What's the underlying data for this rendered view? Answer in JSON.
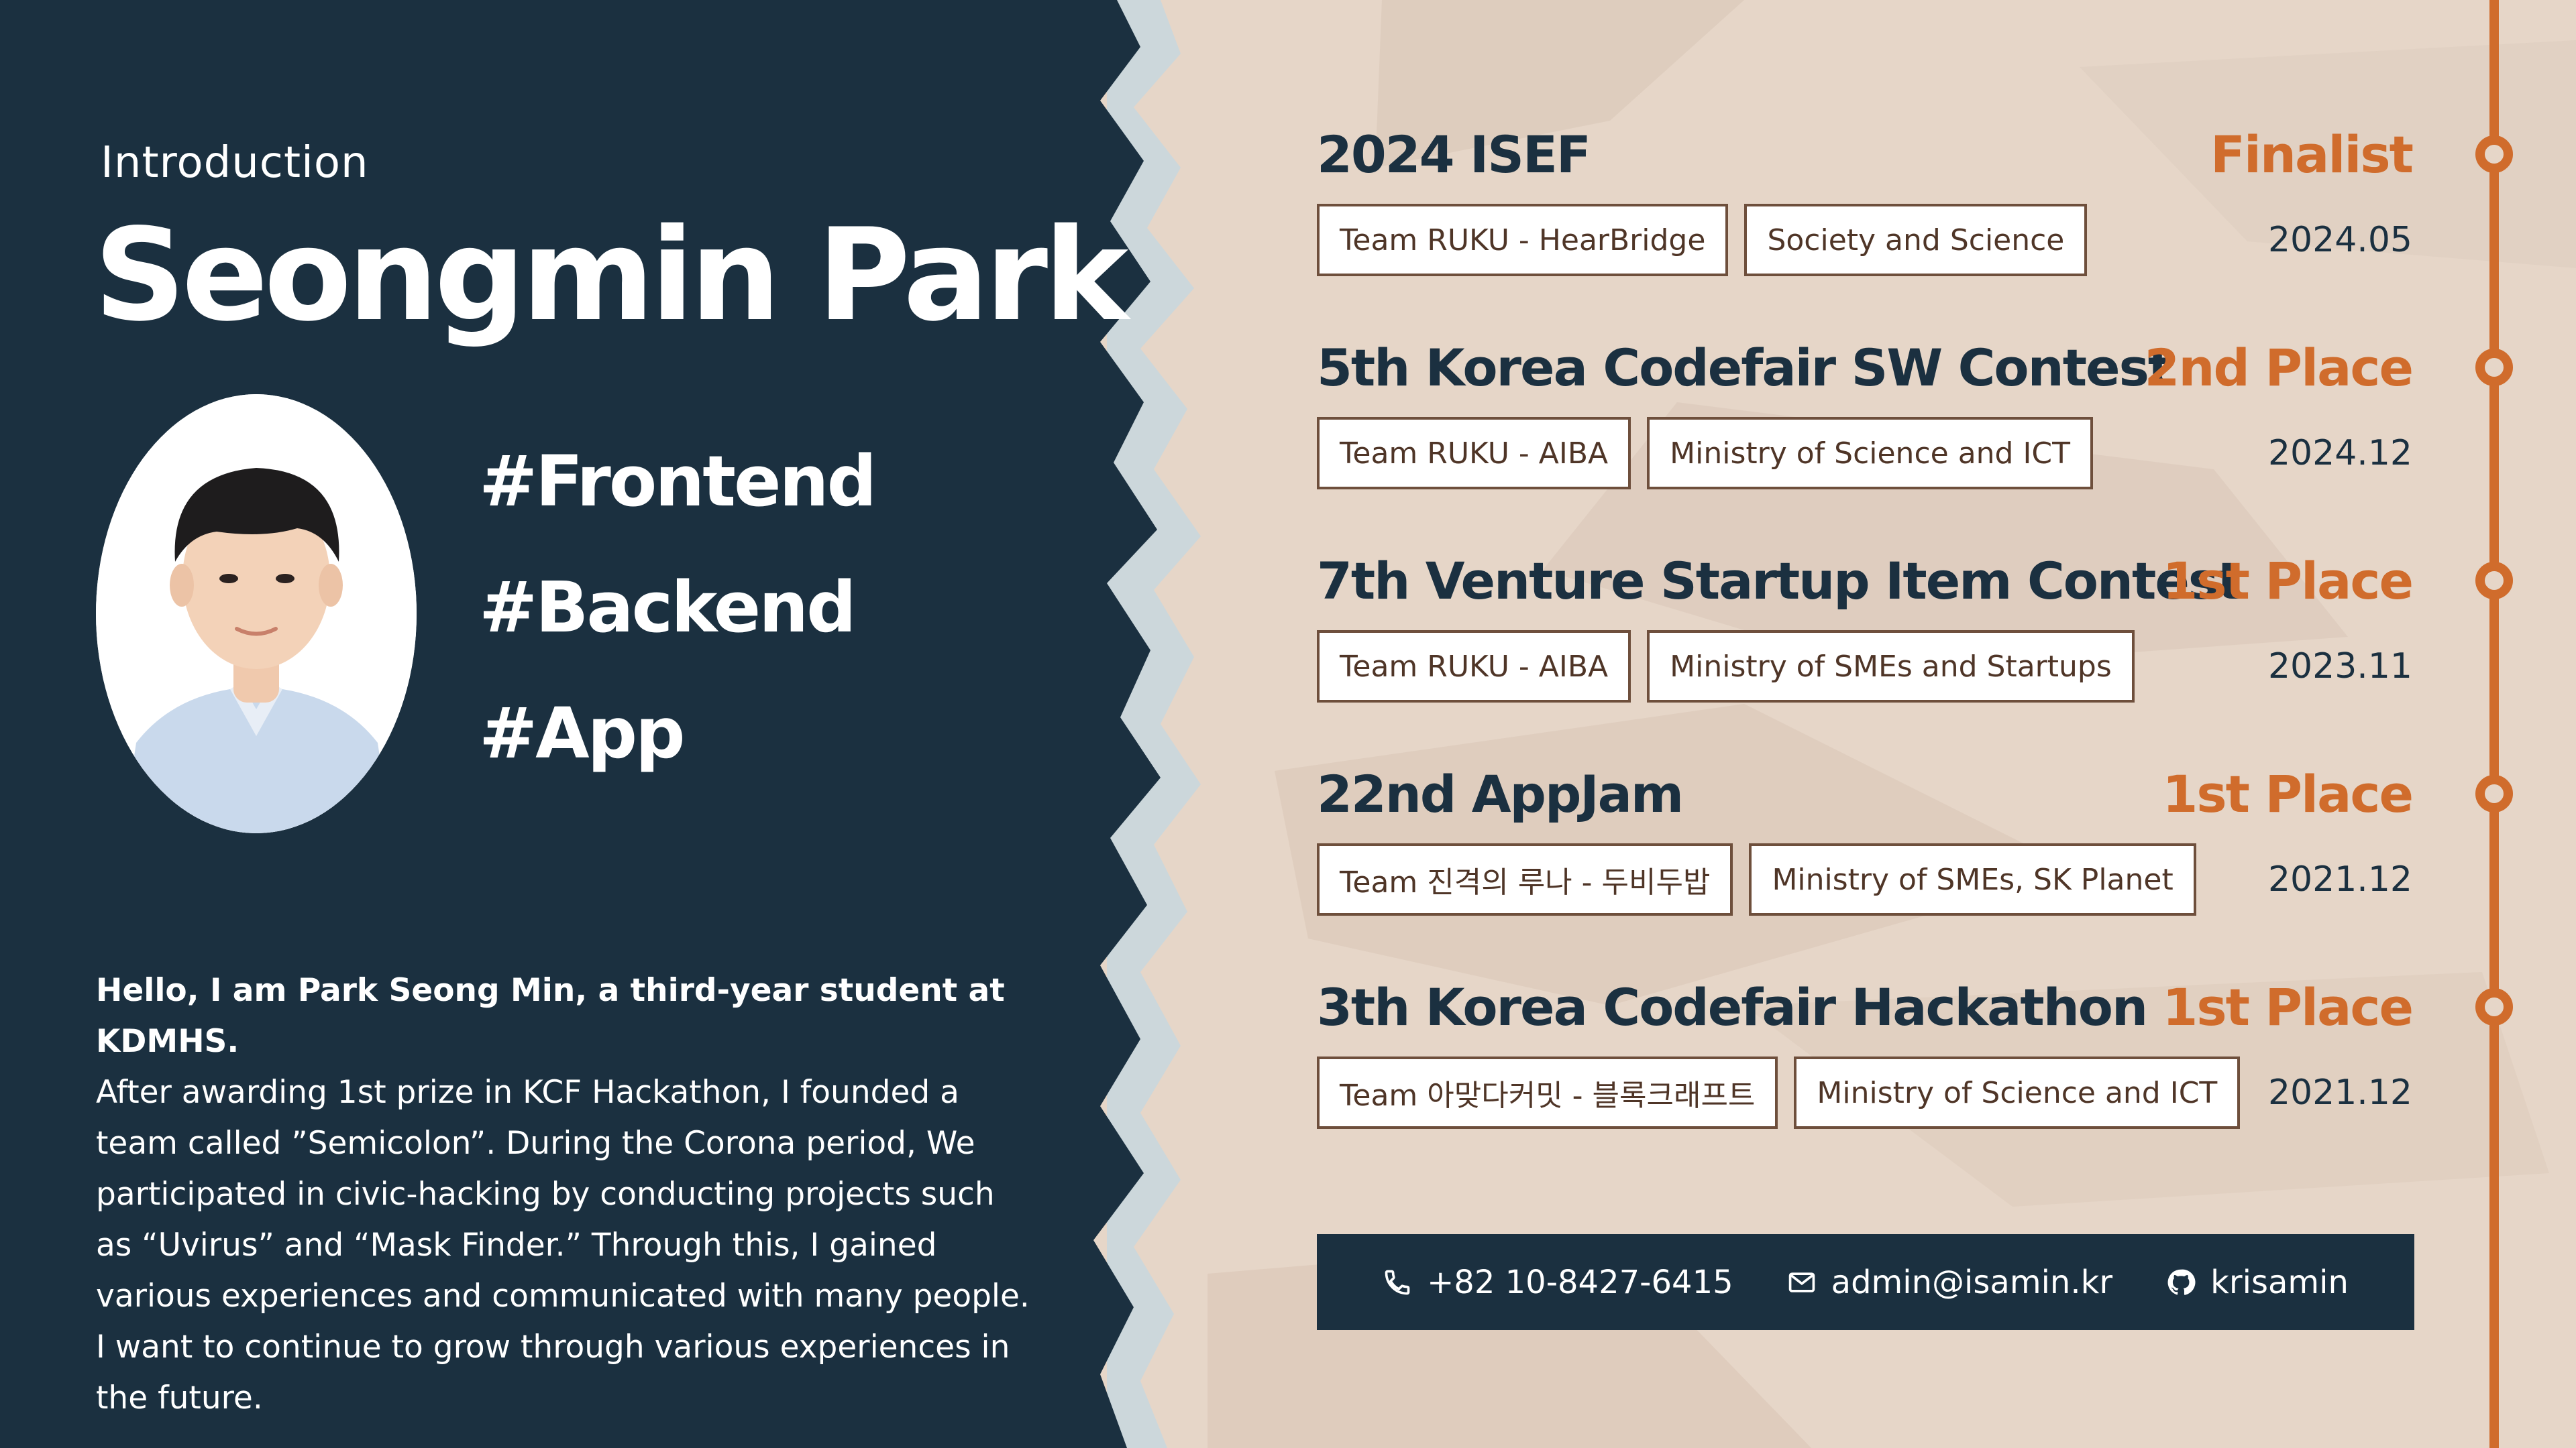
{
  "intro": {
    "label": "Introduction",
    "name": "Seongmin Park",
    "hashtags": [
      "#Frontend",
      "#Backend",
      "#App"
    ],
    "photo_description_icon": "portrait-photo",
    "bio_lead": "Hello, I am Park Seong Min, a third-year student at KDMHS.",
    "bio_body": "After awarding 1st prize in KCF Hackathon, I founded a team called ”Semicolon”. During the Corona period, We participated in civic-hacking by conducting projects such as “Uvirus” and “Mask Finder.” Through this, I gained various experiences and communicated with many people. I want to continue to grow through various experiences in the future."
  },
  "awards": [
    {
      "title": "2024 ISEF",
      "rank": "Finalist",
      "team": "Team RUKU - HearBridge",
      "organizer": "Society and Science",
      "date": "2024.05"
    },
    {
      "title": "5th Korea Codefair SW Contest",
      "rank": "2nd Place",
      "team": "Team RUKU - AIBA",
      "organizer": "Ministry of Science and ICT",
      "date": "2024.12"
    },
    {
      "title": "7th Venture Startup Item Contest",
      "rank": "1st Place",
      "team": "Team RUKU - AIBA",
      "organizer": "Ministry of SMEs and Startups",
      "date": "2023.11"
    },
    {
      "title": "22nd AppJam",
      "rank": "1st Place",
      "team": "Team 진격의 루나 - 두비두밥",
      "organizer": "Ministry of SMEs, SK Planet",
      "date": "2021.12"
    },
    {
      "title": "3th Korea Codefair Hackathon",
      "rank": "1st Place",
      "team": "Team 아맞다커밋 - 블록크래프트",
      "organizer": "Ministry of Science and ICT",
      "date": "2021.12"
    }
  ],
  "contact": {
    "phone_icon": "phone-icon",
    "phone": "+82 10-8427-6415",
    "email_icon": "mail-icon",
    "email": "admin@isamin.kr",
    "github_icon": "github-icon",
    "github": "krisamin"
  },
  "colors": {
    "navy": "#1b3040",
    "accent_orange": "#d06c2c",
    "paper_beige": "#e6d6c8",
    "chip_border": "#6e4f3c"
  }
}
